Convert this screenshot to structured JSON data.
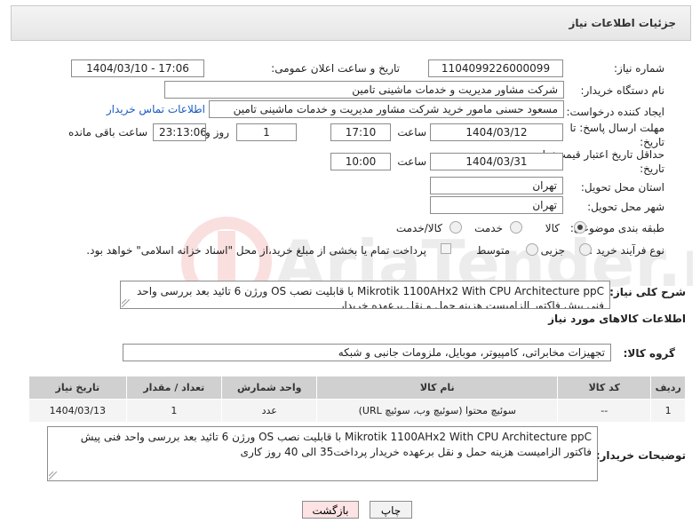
{
  "header": {
    "title": "جزئیات اطلاعات نیاز"
  },
  "form": {
    "need_number_label": "شماره نیاز:",
    "need_number": "1104099226000099",
    "announce_label": "تاریخ و ساعت اعلان عمومی:",
    "announce_value": "1404/03/10 - 17:06",
    "buyer_org_label": "نام دستگاه خریدار:",
    "buyer_org": "شرکت مشاور مدیریت و خدمات ماشینی تامین",
    "creator_label": "ایجاد کننده درخواست:",
    "creator": "مسعود حسنی مامور خرید شرکت مشاور مدیریت و خدمات ماشینی تامین",
    "contact_link": "اطلاعات تماس خریدار",
    "reply_deadline_label": "مهلت ارسال پاسخ: تا تاریخ:",
    "reply_date": "1404/03/12",
    "time_label": "ساعت",
    "reply_time": "17:10",
    "days_value": "1",
    "days_label": "روز و",
    "remaining_value": "23:13:06",
    "remaining_label": "ساعت باقی مانده",
    "validity_label": "حداقل تاریخ اعتبار قیمت: تا تاریخ:",
    "validity_date": "1404/03/31",
    "validity_time": "10:00",
    "province_label": "استان محل تحویل:",
    "province": "تهران",
    "city_label": "شهر محل تحویل:",
    "city": "تهران",
    "category_label": "طبقه بندی موضوعی:",
    "category_options": [
      "کالا",
      "خدمت",
      "کالا/خدمت"
    ],
    "process_label": "نوع فرآیند خرید :",
    "process_options": [
      "جزیی",
      "متوسط"
    ],
    "payment_note": "پرداخت تمام یا بخشی از مبلغ خرید،از محل \"اسناد خزانه اسلامی\" خواهد بود.",
    "description_label": "شرح کلی نیاز:",
    "description": "Mikrotik 1100AHx2 With CPU Architecture  ppC  با قابلیت نصب OS ورژن 6   تائید بعد بررسی واحد فنی پیش فاکتور الزامیست هزینه حمل و نقل برعهده خریدار",
    "goods_info_title": "اطلاعات کالاهای مورد نیاز",
    "goods_group_label": "گروه کالا:",
    "goods_group": "تجهیزات مخابراتی، کامپیوتر، موبایل، ملزومات جانبی و شبکه"
  },
  "table": {
    "headers": [
      "ردیف",
      "کد کالا",
      "نام کالا",
      "واحد شمارش",
      "تعداد / مقدار",
      "تاریخ نیاز"
    ],
    "rows": [
      [
        "1",
        "--",
        "سوئیچ محتوا (سوئیچ وب، سوئیچ URL)",
        "عدد",
        "1",
        "1404/03/13"
      ]
    ]
  },
  "buyer_notes": {
    "label": "توضیحات خریدار:",
    "text": "Mikrotik 1100AHx2 With CPU Architecture  ppC  با قابلیت نصب OS ورژن 6   تائید بعد بررسی واحد فنی پیش فاکتور الزامیست هزینه حمل و نقل برعهده خریدار  پرداخت35 الی 40 روز کاری"
  },
  "buttons": {
    "print": "چاپ",
    "back": "بازگشت"
  },
  "colors": {
    "link": "#1a5bbf",
    "back_button_bg": "#fde3e3"
  }
}
